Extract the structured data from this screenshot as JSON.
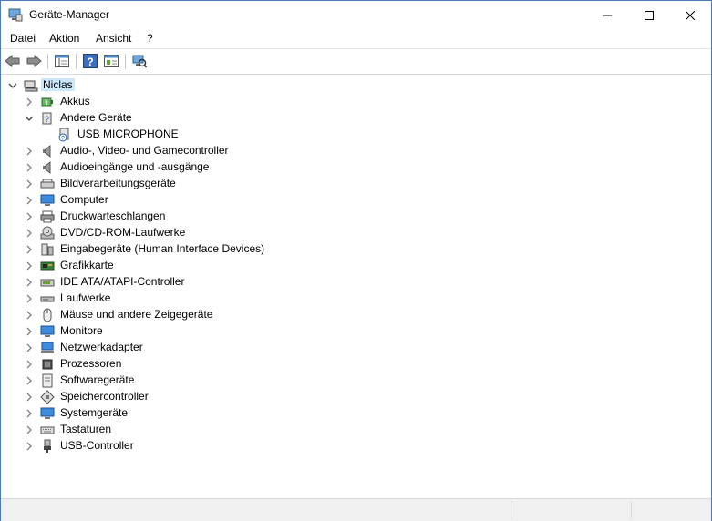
{
  "window": {
    "title": "Geräte-Manager"
  },
  "menu": [
    "Datei",
    "Aktion",
    "Ansicht",
    "?"
  ],
  "tree": {
    "root": "Niclas",
    "categories": [
      {
        "label": "Akkus",
        "icon": "battery-icon",
        "expanded": false
      },
      {
        "label": "Andere Geräte",
        "icon": "unknown-device-icon",
        "expanded": true,
        "children": [
          {
            "label": "USB MICROPHONE",
            "icon": "unknown-device-warning-icon"
          }
        ]
      },
      {
        "label": "Audio-, Video- und Gamecontroller",
        "icon": "speaker-icon",
        "expanded": false
      },
      {
        "label": "Audioeingänge und -ausgänge",
        "icon": "speaker-icon",
        "expanded": false
      },
      {
        "label": "Bildverarbeitungsgeräte",
        "icon": "scanner-icon",
        "expanded": false
      },
      {
        "label": "Computer",
        "icon": "monitor-icon",
        "expanded": false
      },
      {
        "label": "Druckwarteschlangen",
        "icon": "printer-icon",
        "expanded": false
      },
      {
        "label": "DVD/CD-ROM-Laufwerke",
        "icon": "disc-drive-icon",
        "expanded": false
      },
      {
        "label": "Eingabegeräte (Human Interface Devices)",
        "icon": "hid-icon",
        "expanded": false
      },
      {
        "label": "Grafikkarte",
        "icon": "graphics-card-icon",
        "expanded": false
      },
      {
        "label": "IDE ATA/ATAPI-Controller",
        "icon": "ide-controller-icon",
        "expanded": false
      },
      {
        "label": "Laufwerke",
        "icon": "drive-icon",
        "expanded": false
      },
      {
        "label": "Mäuse und andere Zeigegeräte",
        "icon": "mouse-icon",
        "expanded": false
      },
      {
        "label": "Monitore",
        "icon": "monitor-icon",
        "expanded": false
      },
      {
        "label": "Netzwerkadapter",
        "icon": "network-adapter-icon",
        "expanded": false
      },
      {
        "label": "Prozessoren",
        "icon": "processor-icon",
        "expanded": false
      },
      {
        "label": "Softwaregeräte",
        "icon": "software-device-icon",
        "expanded": false
      },
      {
        "label": "Speichercontroller",
        "icon": "storage-controller-icon",
        "expanded": false
      },
      {
        "label": "Systemgeräte",
        "icon": "monitor-icon",
        "expanded": false
      },
      {
        "label": "Tastaturen",
        "icon": "keyboard-icon",
        "expanded": false
      },
      {
        "label": "USB-Controller",
        "icon": "usb-icon",
        "expanded": false
      }
    ]
  },
  "colors": {
    "selection": "#cce8ff",
    "chevron": "#606060",
    "window_border": "#4a7ab8"
  }
}
